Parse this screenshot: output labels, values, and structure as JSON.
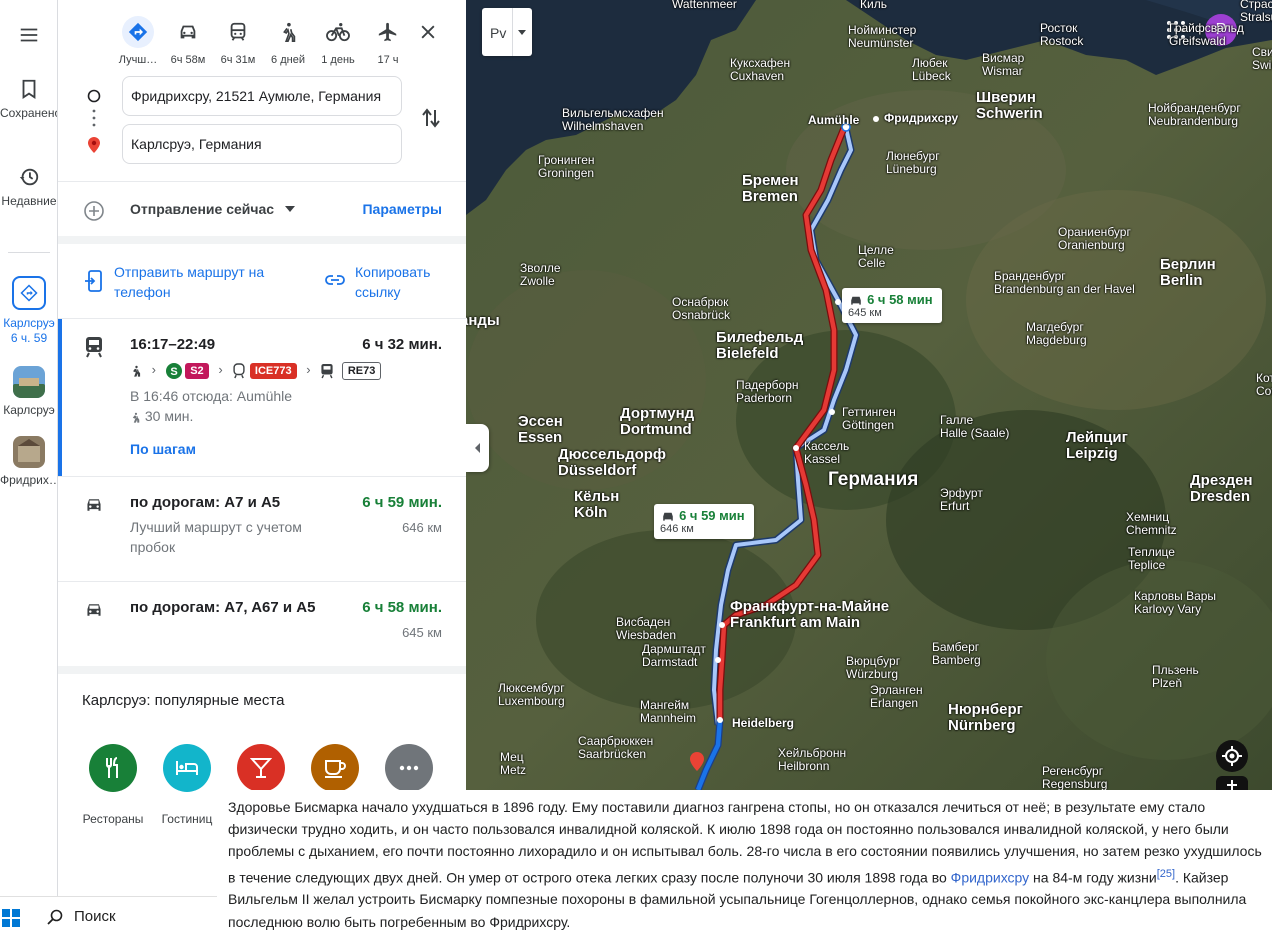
{
  "rail": {
    "saved_label": "Сохранено",
    "recent_label": "Недавние",
    "item1_label": "Карлсруэ 6 ч. 59",
    "item2_label": "Карлсруэ",
    "item3_label": "Фридрих…"
  },
  "modes": [
    {
      "icon": "directions-icon",
      "label": "Лучш…"
    },
    {
      "icon": "car-icon",
      "label": "6ч 58м"
    },
    {
      "icon": "transit-icon",
      "label": "6ч 31м"
    },
    {
      "icon": "walk-icon",
      "label": "6 дней"
    },
    {
      "icon": "bike-icon",
      "label": "1 день"
    },
    {
      "icon": "plane-icon",
      "label": "17 ч"
    }
  ],
  "origin": "Фридрихсру, 21521 Аумюле, Германия",
  "destination": "Карлсруэ, Германия",
  "departure": {
    "label": "Отправление сейчас",
    "options": "Параметры"
  },
  "share": {
    "send_phone": "Отправить маршрут на телефон",
    "copy_link": "Копировать ссылку"
  },
  "routes": {
    "transit": {
      "times": "16:17–22:49",
      "duration": "6 ч 32 мин.",
      "s_line": "S2",
      "ice_line": "ICE773",
      "re_line": "RE73",
      "depart_info": "В 16:46 отсюда: Aumühle",
      "walk": "30 мин.",
      "steps": "По шагам"
    },
    "drive1": {
      "title": "по дорогам: A7 и A5",
      "duration": "6 ч 59 мин.",
      "sub": "Лучший маршрут с учетом пробок",
      "dist": "646 км"
    },
    "drive2": {
      "title": "по дорогам: A7, A67 и A5",
      "duration": "6 ч 58 мин.",
      "dist": "645 км"
    }
  },
  "popular": {
    "heading": "Карлсруэ: популярные места",
    "categories": [
      {
        "label": "Рестораны",
        "color": "#188038"
      },
      {
        "label": "Гостиниц",
        "color": "#12b5cb"
      },
      {
        "label": "",
        "color": "#d93025"
      },
      {
        "label": "",
        "color": "#b06000"
      },
      {
        "label": "",
        "color": "#70757a"
      }
    ]
  },
  "map": {
    "layer_label": "Рv",
    "user_initial": "P",
    "card1": {
      "time": "6 ч 58 мин",
      "dist": "645 км"
    },
    "card2": {
      "time": "6 ч 59 мин",
      "dist": "646 км"
    },
    "cities": [
      {
        "ru": "Киль",
        "de": ""
      },
      {
        "ru": "Нойминстер",
        "de": "Neumünster"
      },
      {
        "ru": "Росток",
        "de": "Rostock"
      },
      {
        "ru": "Грайфсвальд",
        "de": "Greifswald"
      },
      {
        "ru": "Куксхафен",
        "de": "Cuxhaven"
      },
      {
        "ru": "Любек",
        "de": "Lübeck"
      },
      {
        "ru": "Висмар",
        "de": "Wismar"
      },
      {
        "ru": "Шверин",
        "de": "Schwerin"
      },
      {
        "ru": "Вильгельмсхафен",
        "de": "Wilhelmshaven"
      },
      {
        "ru": "Aumühle",
        "de": ""
      },
      {
        "ru": "Фридрихсру",
        "de": ""
      },
      {
        "ru": "Нойбранденбург",
        "de": "Neubrandenburg"
      },
      {
        "ru": "Гронинген",
        "de": "Groningen"
      },
      {
        "ru": "Люнебург",
        "de": "Lüneburg"
      },
      {
        "ru": "Бремен",
        "de": "Bremen"
      },
      {
        "ru": "Ораниенбург",
        "de": "Oranienburg"
      },
      {
        "ru": "Целле",
        "de": "Celle"
      },
      {
        "ru": "Зволле",
        "de": "Zwolle"
      },
      {
        "ru": "Бранденбург",
        "de": "Brandenburg an der Havel"
      },
      {
        "ru": "Берлин",
        "de": "Berlin"
      },
      {
        "ru": "Оснабрюк",
        "de": "Osnabrück"
      },
      {
        "ru": "Магдебург",
        "de": "Magdeburg"
      },
      {
        "ru": "Билефельд",
        "de": "Bielefeld"
      },
      {
        "ru": "Падерборн",
        "de": "Paderborn"
      },
      {
        "ru": "Эссен",
        "de": "Essen"
      },
      {
        "ru": "Дортмунд",
        "de": "Dortmund"
      },
      {
        "ru": "Геттинген",
        "de": "Göttingen"
      },
      {
        "ru": "Галле",
        "de": "Halle (Saale)"
      },
      {
        "ru": "Лейпциг",
        "de": "Leipzig"
      },
      {
        "ru": "Дюссельдорф",
        "de": "Düsseldorf"
      },
      {
        "ru": "Кассель",
        "de": "Kassel"
      },
      {
        "ru": "Германия",
        "de": ""
      },
      {
        "ru": "Эрфурт",
        "de": "Erfurt"
      },
      {
        "ru": "Дрезден",
        "de": "Dresden"
      },
      {
        "ru": "Кёльн",
        "de": "Köln"
      },
      {
        "ru": "Хемниц",
        "de": "Chemnitz"
      },
      {
        "ru": "Теплице",
        "de": "Teplice"
      },
      {
        "ru": "Франкфурт-на-Майне",
        "de": "Frankfurt am Main"
      },
      {
        "ru": "Висбаден",
        "de": "Wiesbaden"
      },
      {
        "ru": "Карловы Вары",
        "de": "Karlovy Vary"
      },
      {
        "ru": "Дармштадт",
        "de": "Darmstadt"
      },
      {
        "ru": "Бамберг",
        "de": "Bamberg"
      },
      {
        "ru": "Вюрцбург",
        "de": "Würzburg"
      },
      {
        "ru": "Пльзень",
        "de": "Plzeň"
      },
      {
        "ru": "Люксембург",
        "de": "Luxembourg"
      },
      {
        "ru": "Эрланген",
        "de": "Erlangen"
      },
      {
        "ru": "Мангейм",
        "de": "Mannheim"
      },
      {
        "ru": "Heidelberg",
        "de": ""
      },
      {
        "ru": "Нюрнберг",
        "de": "Nürnberg"
      },
      {
        "ru": "Саарбрюккен",
        "de": "Saarbrücken"
      },
      {
        "ru": "Хейльбронн",
        "de": "Heilbronn"
      },
      {
        "ru": "Мец",
        "de": "Metz"
      },
      {
        "ru": "Регенсбург",
        "de": "Regensburg"
      },
      {
        "ru": "анды",
        "de": ""
      },
      {
        "ru": "Wattenmeer",
        "de": ""
      },
      {
        "ru": "Страсунд",
        "de": "Stralsund"
      },
      {
        "ru": "Свине",
        "de": "Swine"
      },
      {
        "ru": "Кот",
        "de": "Cott"
      }
    ]
  },
  "article": {
    "text_before": "Здоровье Бисмарка начало ухудшаться в 1896 году. Ему поставили диагноз гангрена стопы, но он отказался лечиться от неё; в результате ему стало физически трудно ходить, и он часто пользовался инвалидной коляской. К июлю 1898 года он постоянно пользовался инвалидной коляской, у него были проблемы с дыханием, его почти постоянно лихорадило и он испытывал боль. 28-го числа в его состоянии появились улучшения, но затем резко ухудшилось в течение следующих двух дней. Он умер от острого отека легких сразу после полуночи 30 июля 1898 года во ",
    "link": "Фридрихсру",
    "text_mid": " на 84-м году жизни",
    "ref": "[25]",
    "text_after": ". Кайзер Вильгельм II желал устроить Бисмарку помпезные похороны в фамильной усыпальнице Гогенцоллернов, однако семья покойного экс-канцлера выполнила последнюю волю быть погребенным во Фридрихсру."
  },
  "taskbar": {
    "search_label": "Поиск"
  }
}
